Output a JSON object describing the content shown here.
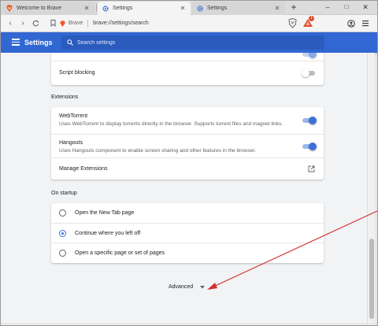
{
  "tabs": [
    {
      "title": "Welcome to Brave",
      "active": false
    },
    {
      "title": "Settings",
      "active": true
    },
    {
      "title": "Settings",
      "active": false
    }
  ],
  "window_controls": {
    "minimize": "–",
    "maximize": "□",
    "close": "✕"
  },
  "toolbar": {
    "brand": "Brave",
    "url": "brave://settings/search",
    "rewards_badge": "1"
  },
  "header": {
    "title": "Settings",
    "search_placeholder": "Search settings"
  },
  "privacy": {
    "script_blocking_label": "Script blocking",
    "script_blocking_enabled": false
  },
  "extensions": {
    "section_title": "Extensions",
    "webtorrent": {
      "title": "WebTorrent",
      "description": "Uses WebTorrent to display torrents directly in the browser. Supports torrent files and magnet links.",
      "enabled": true
    },
    "hangouts": {
      "title": "Hangouts",
      "description": "Uses Hangouts component to enable screen sharing and other features in the browser.",
      "enabled": true
    },
    "manage_label": "Manage Extensions"
  },
  "startup": {
    "section_title": "On startup",
    "options": [
      {
        "label": "Open the New Tab page",
        "checked": false
      },
      {
        "label": "Continue where you left off",
        "checked": true
      },
      {
        "label": "Open a specific page or set of pages",
        "checked": false
      }
    ]
  },
  "advanced_label": "Advanced",
  "colors": {
    "accent": "#3167d3",
    "toggle_on": "#3b71d8",
    "annotation_arrow": "#d32f2f"
  }
}
